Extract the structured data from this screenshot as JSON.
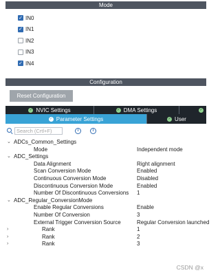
{
  "mode": {
    "title": "Mode",
    "channels": [
      {
        "label": "IN0",
        "checked": true
      },
      {
        "label": "IN1",
        "checked": true
      },
      {
        "label": "IN2",
        "checked": false
      },
      {
        "label": "IN3",
        "checked": false
      },
      {
        "label": "IN4",
        "checked": true
      }
    ]
  },
  "configuration": {
    "title": "Configuration",
    "reset_label": "Reset Configuration",
    "tabs_row1": [
      "NVIC Settings",
      "DMA Settings"
    ],
    "tabs_row2": [
      "Parameter Settings",
      "User"
    ],
    "search": {
      "placeholder": "Search (Crtl+F)"
    },
    "tree": [
      {
        "name": "ADCs_Common_Settings",
        "value": "",
        "toggle": "⌄"
      },
      {
        "name": "Mode",
        "value": "Independent mode",
        "toggle": ""
      },
      {
        "name": "ADC_Settings",
        "value": "",
        "toggle": "⌄"
      },
      {
        "name": "Data Alignment",
        "value": "Right alignment",
        "toggle": ""
      },
      {
        "name": "Scan Conversion Mode",
        "value": "Enabled",
        "toggle": ""
      },
      {
        "name": "Continuous Conversion Mode",
        "value": "Disabled",
        "toggle": ""
      },
      {
        "name": "Discontinuous Conversion Mode",
        "value": "Enabled",
        "toggle": ""
      },
      {
        "name": "Number Of Discontinuous Conversions",
        "value": "1",
        "toggle": ""
      },
      {
        "name": "ADC_Regular_ConversionMode",
        "value": "",
        "toggle": "⌄"
      },
      {
        "name": "Enable Regular Conversions",
        "value": "Enable",
        "toggle": ""
      },
      {
        "name": "Number Of Conversion",
        "value": "3",
        "toggle": ""
      },
      {
        "name": "External Trigger Conversion Source",
        "value": "Regular Conversion launched",
        "toggle": ""
      },
      {
        "name": "Rank",
        "value": "1",
        "toggle": "›"
      },
      {
        "name": "Rank",
        "value": "2",
        "toggle": "›"
      },
      {
        "name": "Rank",
        "value": "3",
        "toggle": "›"
      }
    ]
  },
  "watermark": "CSDN @x",
  "colors": {
    "header_bg": "#4e5560",
    "tab_active": "#39a3d6",
    "tab_bg": "#1f252b",
    "checkbox_checked": "#2f6bb2",
    "button_bg": "#9fa5ab"
  }
}
